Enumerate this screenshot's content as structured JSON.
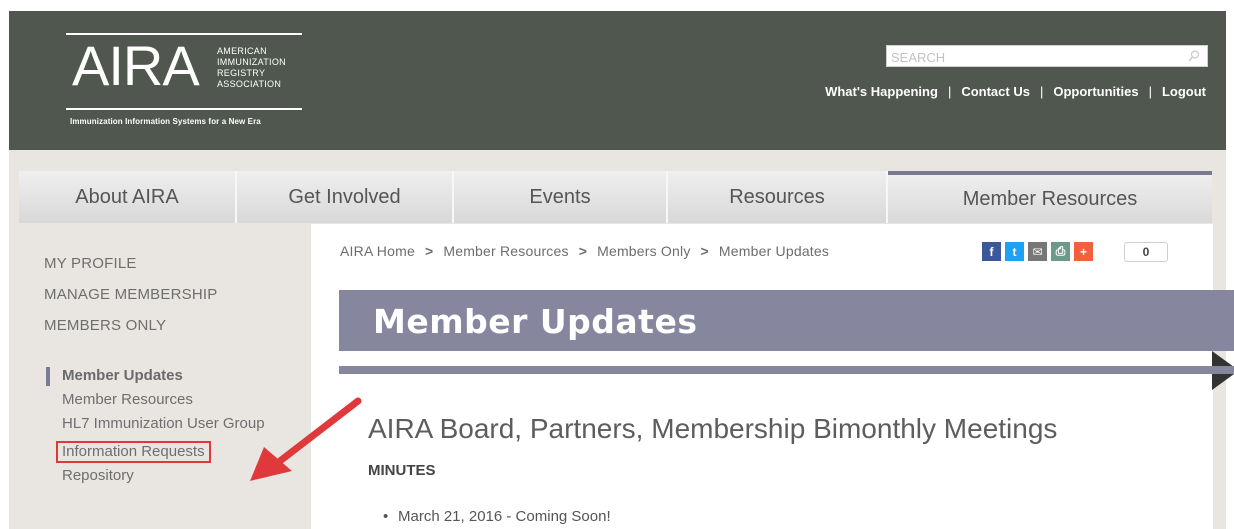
{
  "header": {
    "logo": {
      "mark": "AIRA",
      "full_name": [
        "AMERICAN",
        "IMMUNIZATION",
        "REGISTRY",
        "ASSOCIATION"
      ],
      "tagline": "Immunization Information Systems for a New Era"
    },
    "search": {
      "placeholder": "SEARCH"
    },
    "links": [
      "What's Happening",
      "Contact Us",
      "Opportunities",
      "Logout"
    ],
    "separator": "|"
  },
  "nav": {
    "tabs": [
      {
        "label": "About AIRA"
      },
      {
        "label": "Get Involved"
      },
      {
        "label": "Events"
      },
      {
        "label": "Resources"
      },
      {
        "label": "Member Resources",
        "active": true
      }
    ]
  },
  "sidebar": {
    "top_items": [
      "MY PROFILE",
      "MANAGE MEMBERSHIP",
      "MEMBERS ONLY"
    ],
    "sub_items": [
      {
        "label": "Member Updates",
        "active": true
      },
      {
        "label": "Member Resources"
      },
      {
        "label": "HL7 Immunization User Group"
      },
      {
        "label": "Information Requests",
        "highlighted": true
      },
      {
        "label": "Repository"
      }
    ]
  },
  "breadcrumb": {
    "items": [
      "AIRA Home",
      "Member Resources",
      "Members Only",
      "Member Updates"
    ],
    "separator": ">"
  },
  "share": {
    "buttons": [
      {
        "icon": "facebook-icon",
        "glyph": "f",
        "color": "#3b5998"
      },
      {
        "icon": "twitter-icon",
        "glyph": "t",
        "color": "#1da1f2"
      },
      {
        "icon": "email-icon",
        "glyph": "✉",
        "color": "#777777"
      },
      {
        "icon": "print-icon",
        "glyph": "⎙",
        "color": "#6a9a8a"
      },
      {
        "icon": "plus-icon",
        "glyph": "+",
        "color": "#f2603f"
      }
    ],
    "count": "0"
  },
  "page": {
    "banner_title": "Member Updates",
    "article_title": "AIRA Board, Partners, Membership Bimonthly Meetings",
    "minutes_heading": "MINUTES",
    "list_items": [
      "March 21, 2016 - Coming Soon!"
    ]
  },
  "colors": {
    "header_bg": "#4f574e",
    "accent": "#86869f",
    "highlight_box": "#e0393c",
    "arrow": "#e0393c"
  }
}
